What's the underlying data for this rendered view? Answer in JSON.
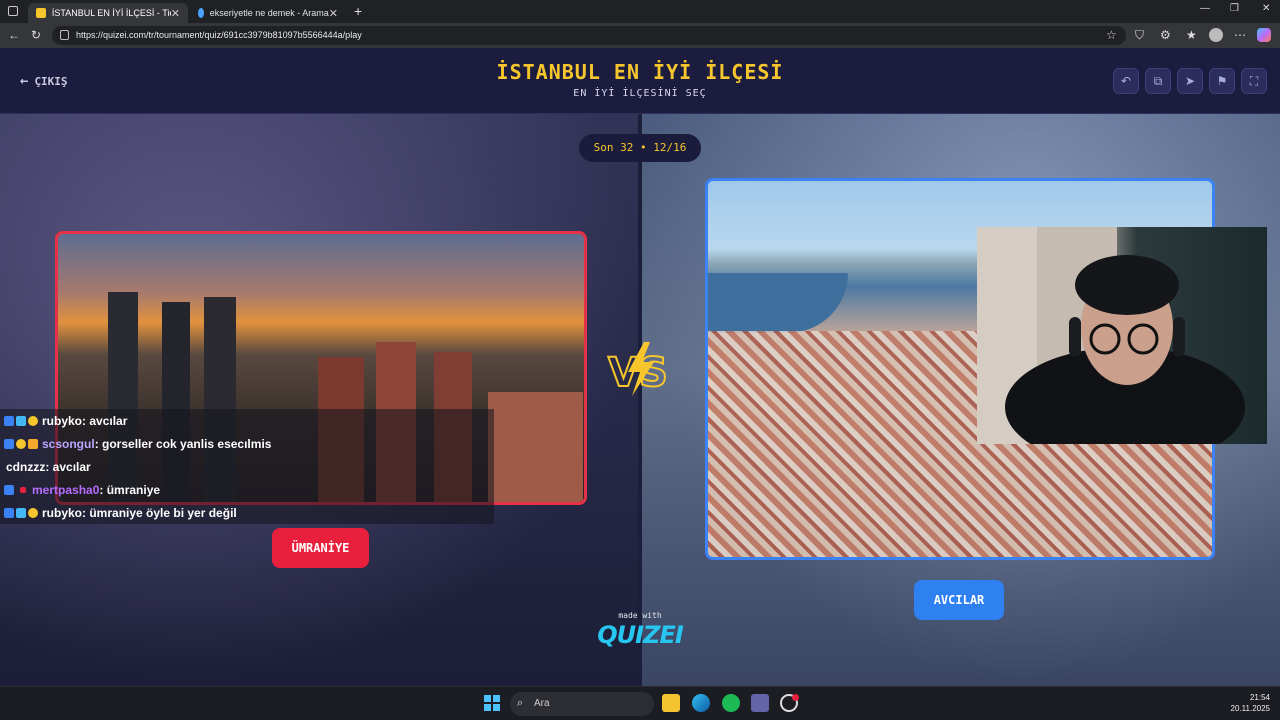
{
  "browser": {
    "tabs": [
      {
        "title": "İSTANBUL EN İYİ İLÇESİ - Tier List",
        "close": "✕",
        "active": true
      },
      {
        "title": "ekseriyetle ne demek - Arama",
        "close": "✕",
        "active": false
      }
    ],
    "new_tab": "+",
    "url": "https://quizei.com/tr/tournament/quiz/691cc3979b81097b5566444a/play"
  },
  "header": {
    "exit_label": "ÇIKIŞ",
    "title": "İSTANBUL EN İYİ İLÇESİ",
    "subtitle": "EN İYİ İLÇESİNİ SEÇ"
  },
  "progress": "Son 32 • 12/16",
  "left_option": {
    "label": "ÜMRANİYE"
  },
  "right_option": {
    "label": "AVCILAR"
  },
  "chat": [
    {
      "user": "rubyko",
      "message": " : avcılar",
      "color": "#ffffff"
    },
    {
      "user": "scsongul",
      "message": " : gorseller cok yanlis esecılmis",
      "color": "#b9a7ff"
    },
    {
      "user": "cdnzzz",
      "message": " : avcılar",
      "color": "#ffffff"
    },
    {
      "user": "mertpasha0",
      "message": " : ümraniye",
      "color": "#b66dff"
    },
    {
      "user": "rubyko",
      "message": " : ümraniye öyle bi yer değil",
      "color": "#ffffff"
    }
  ],
  "branding": {
    "made_with": "made with",
    "logo": "QUIZEI"
  },
  "taskbar": {
    "search_placeholder": "Ara",
    "time": "21:54",
    "date": "20.11.2025"
  },
  "colors": {
    "accent_yellow": "#f6c62c",
    "left_red": "#e8203d",
    "right_blue": "#2f80f0",
    "header_bg": "#1c1c3f"
  }
}
